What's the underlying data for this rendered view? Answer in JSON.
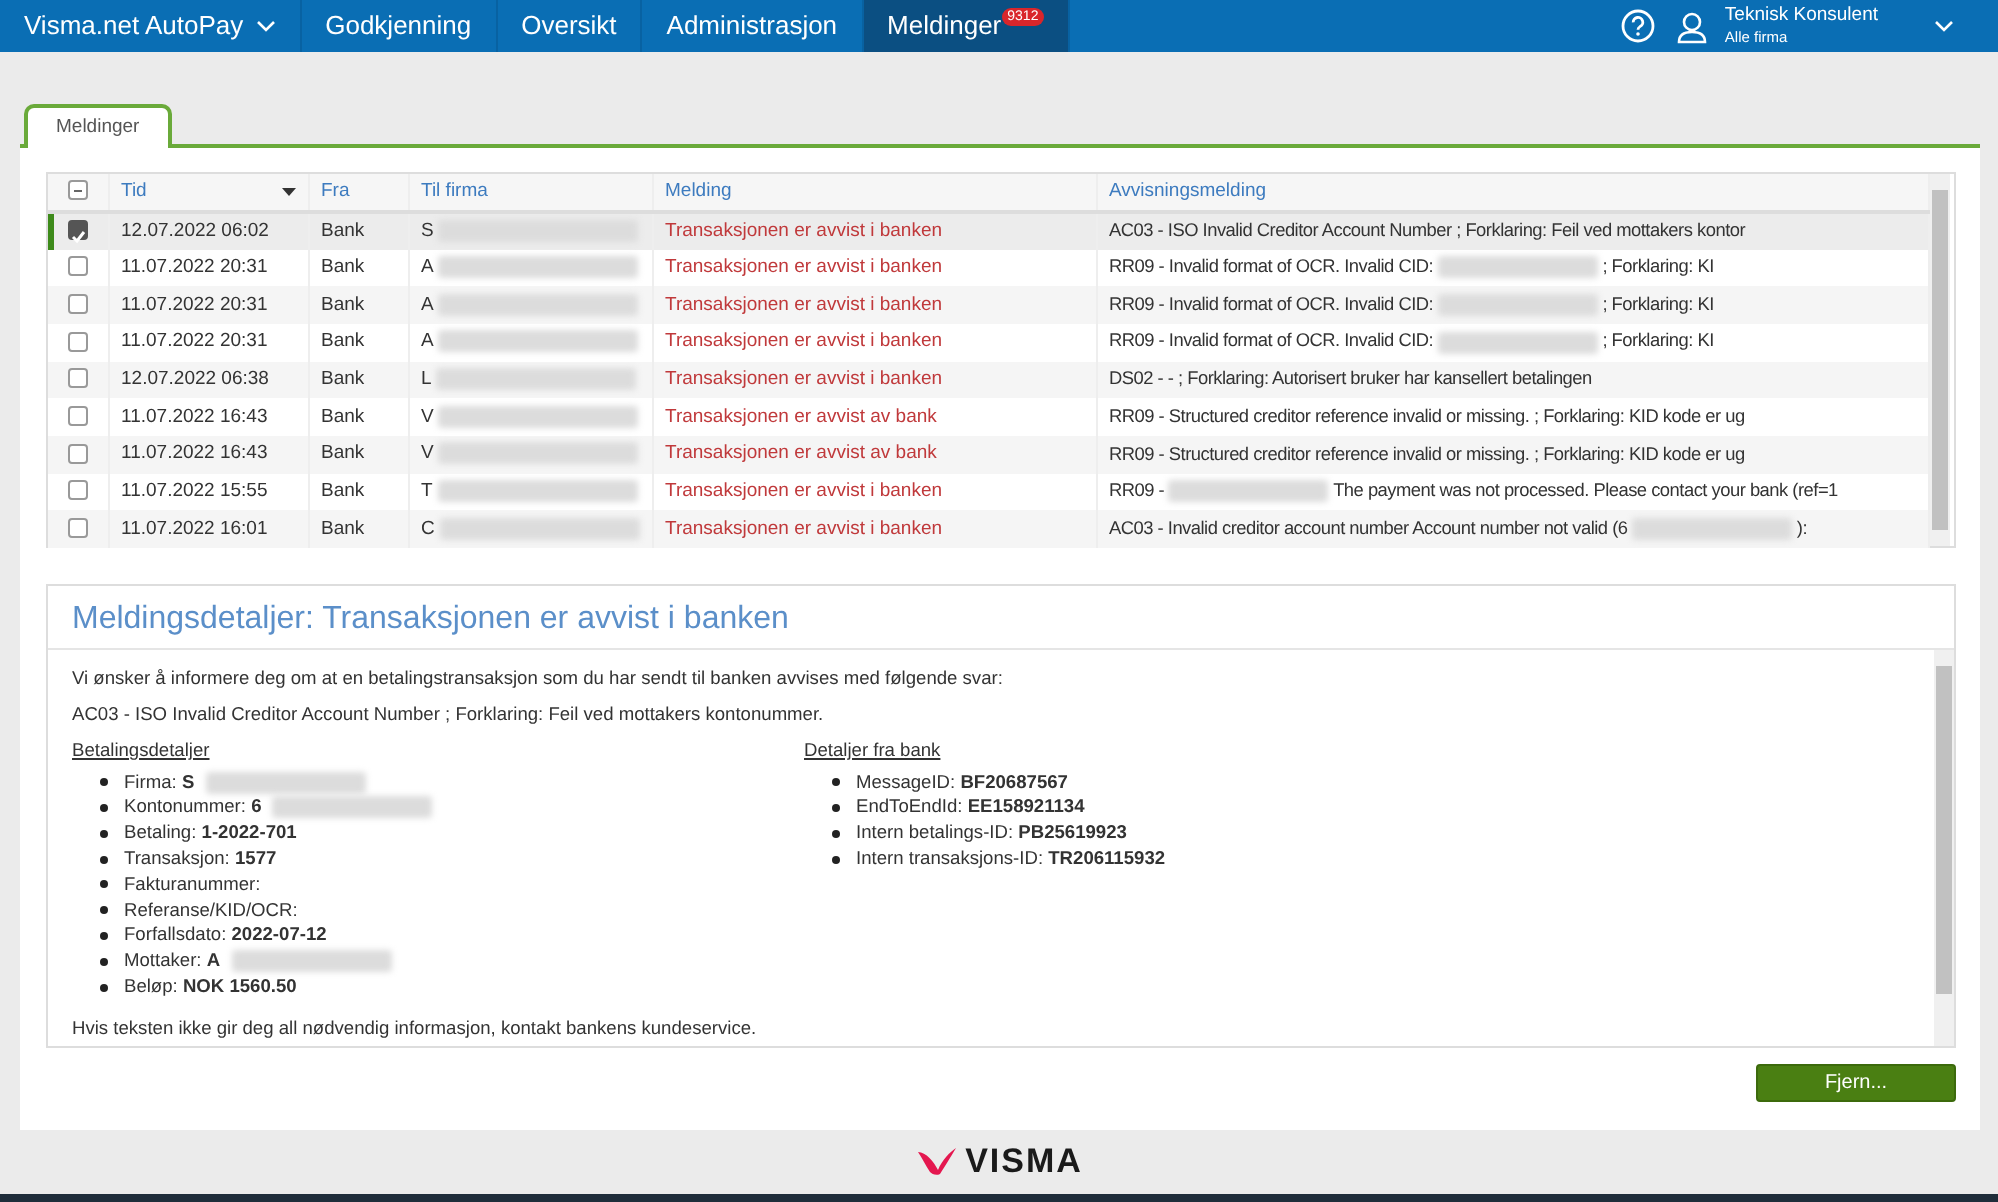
{
  "navbar": {
    "brand": "Visma.net AutoPay",
    "items": [
      {
        "label": "Godkjenning",
        "selected": false
      },
      {
        "label": "Oversikt",
        "selected": false
      },
      {
        "label": "Administrasjon",
        "selected": false
      },
      {
        "label": "Meldinger",
        "selected": true,
        "badge": "9312"
      }
    ],
    "user": {
      "name": "Teknisk Konsulent",
      "company": "Alle firma"
    }
  },
  "tabs": [
    {
      "label": "Meldinger",
      "selected": true
    }
  ],
  "table": {
    "select_all_partial": true,
    "columns": [
      {
        "label": "Tid",
        "sorted": true
      },
      {
        "label": "Fra",
        "sorted": false
      },
      {
        "label": "Til firma",
        "sorted": false
      },
      {
        "label": "Melding",
        "sorted": false
      },
      {
        "label": "Avvisningsmelding",
        "sorted": false
      }
    ],
    "rows": [
      {
        "selected": true,
        "checked": true,
        "tid": "12.07.2022 06:02",
        "fra": "Bank",
        "til_firma": [
          {
            "kind": "text",
            "text": "S"
          },
          {
            "kind": "redacted"
          }
        ],
        "melding": "Transaksjonen er avvist i banken",
        "avvisning": [
          {
            "kind": "text",
            "text": "AC03 - ISO Invalid Creditor Account Number ; Forklaring: Feil ved mottakers kontor"
          }
        ]
      },
      {
        "selected": false,
        "checked": false,
        "tid": "11.07.2022 20:31",
        "fra": "Bank",
        "til_firma": [
          {
            "kind": "text",
            "text": "A"
          },
          {
            "kind": "redacted"
          }
        ],
        "melding": "Transaksjonen er avvist i banken",
        "avvisning": [
          {
            "kind": "text",
            "text": "RR09 - Invalid format of OCR. Invalid CID:"
          },
          {
            "kind": "redacted"
          },
          {
            "kind": "text",
            "text": "; Forklaring: KI"
          }
        ]
      },
      {
        "selected": false,
        "checked": false,
        "tid": "11.07.2022 20:31",
        "fra": "Bank",
        "til_firma": [
          {
            "kind": "text",
            "text": "A"
          },
          {
            "kind": "redacted"
          }
        ],
        "melding": "Transaksjonen er avvist i banken",
        "avvisning": [
          {
            "kind": "text",
            "text": "RR09 - Invalid format of OCR. Invalid CID:"
          },
          {
            "kind": "redacted"
          },
          {
            "kind": "text",
            "text": "; Forklaring: KI"
          }
        ]
      },
      {
        "selected": false,
        "checked": false,
        "tid": "11.07.2022 20:31",
        "fra": "Bank",
        "til_firma": [
          {
            "kind": "text",
            "text": "A"
          },
          {
            "kind": "redacted"
          }
        ],
        "melding": "Transaksjonen er avvist i banken",
        "avvisning": [
          {
            "kind": "text",
            "text": "RR09 - Invalid format of OCR. Invalid CID:"
          },
          {
            "kind": "redacted"
          },
          {
            "kind": "text",
            "text": "; Forklaring: KI"
          }
        ]
      },
      {
        "selected": false,
        "checked": false,
        "tid": "12.07.2022 06:38",
        "fra": "Bank",
        "til_firma": [
          {
            "kind": "text",
            "text": "L"
          },
          {
            "kind": "redacted"
          }
        ],
        "melding": "Transaksjonen er avvist i banken",
        "avvisning": [
          {
            "kind": "text",
            "text": "DS02 - - ; Forklaring: Autorisert bruker har kansellert betalingen"
          }
        ]
      },
      {
        "selected": false,
        "checked": false,
        "tid": "11.07.2022 16:43",
        "fra": "Bank",
        "til_firma": [
          {
            "kind": "text",
            "text": "V"
          },
          {
            "kind": "redacted"
          }
        ],
        "melding": "Transaksjonen er avvist av bank",
        "avvisning": [
          {
            "kind": "text",
            "text": "RR09 - Structured creditor reference invalid or missing. ; Forklaring: KID kode er ug"
          }
        ]
      },
      {
        "selected": false,
        "checked": false,
        "tid": "11.07.2022 16:43",
        "fra": "Bank",
        "til_firma": [
          {
            "kind": "text",
            "text": "V"
          },
          {
            "kind": "redacted"
          }
        ],
        "melding": "Transaksjonen er avvist av bank",
        "avvisning": [
          {
            "kind": "text",
            "text": "RR09 - Structured creditor reference invalid or missing. ; Forklaring: KID kode er ug"
          }
        ]
      },
      {
        "selected": false,
        "checked": false,
        "tid": "11.07.2022 15:55",
        "fra": "Bank",
        "til_firma": [
          {
            "kind": "text",
            "text": "T"
          },
          {
            "kind": "redacted"
          }
        ],
        "melding": "Transaksjonen er avvist i banken",
        "avvisning": [
          {
            "kind": "text",
            "text": "RR09 -"
          },
          {
            "kind": "redacted"
          },
          {
            "kind": "text",
            "text": "The payment was not processed. Please contact your bank (ref=1"
          }
        ]
      },
      {
        "selected": false,
        "checked": false,
        "tid": "11.07.2022 16:01",
        "fra": "Bank",
        "til_firma": [
          {
            "kind": "text",
            "text": "C"
          },
          {
            "kind": "redacted"
          }
        ],
        "melding": "Transaksjonen er avvist i banken",
        "avvisning": [
          {
            "kind": "text",
            "text": "AC03 - Invalid creditor account number Account number not valid (6"
          },
          {
            "kind": "redacted"
          },
          {
            "kind": "text",
            "text": "):"
          }
        ]
      }
    ]
  },
  "details": {
    "title": "Meldingsdetaljer: Transaksjonen er avvist i banken",
    "intro": "Vi ønsker å informere deg om at en betalingstransaksjon som du har sendt til banken avvises med følgende svar:",
    "reason": "AC03 - ISO Invalid Creditor Account Number ; Forklaring: Feil ved mottakers kontonummer.",
    "payment": {
      "heading": "Betalingsdetaljer",
      "items": [
        {
          "label": "Firma:",
          "value": [
            {
              "kind": "text",
              "text": "S"
            },
            {
              "kind": "redacted"
            }
          ]
        },
        {
          "label": "Kontonummer:",
          "value": [
            {
              "kind": "text",
              "text": "6"
            },
            {
              "kind": "redacted"
            }
          ]
        },
        {
          "label": "Betaling:",
          "value": [
            {
              "kind": "text",
              "text": "1-2022-701"
            }
          ]
        },
        {
          "label": "Transaksjon:",
          "value": [
            {
              "kind": "text",
              "text": "1577"
            }
          ]
        },
        {
          "label": "Fakturanummer:",
          "value": []
        },
        {
          "label": "Referanse/KID/OCR:",
          "value": []
        },
        {
          "label": "Forfallsdato:",
          "value": [
            {
              "kind": "text",
              "text": "2022-07-12"
            }
          ]
        },
        {
          "label": "Mottaker:",
          "value": [
            {
              "kind": "text",
              "text": "A"
            },
            {
              "kind": "redacted"
            }
          ]
        },
        {
          "label": "Beløp:",
          "value": [
            {
              "kind": "text",
              "text": "NOK 1560.50"
            }
          ]
        }
      ]
    },
    "bank": {
      "heading": "Detaljer fra bank",
      "items": [
        {
          "label": "MessageID:",
          "value": [
            {
              "kind": "text",
              "text": "BF20687567"
            }
          ]
        },
        {
          "label": "EndToEndId:",
          "value": [
            {
              "kind": "text",
              "text": "EE158921134"
            }
          ]
        },
        {
          "label": "Intern betalings-ID:",
          "value": [
            {
              "kind": "text",
              "text": "PB25619923"
            }
          ]
        },
        {
          "label": "Intern transaksjons-ID:",
          "value": [
            {
              "kind": "text",
              "text": "TR206115932"
            }
          ]
        }
      ]
    },
    "footer": "Hvis teksten ikke gir deg all nødvendig informasjon, kontakt bankens kundeservice."
  },
  "button": "Fjern...",
  "logo": "VISMA"
}
